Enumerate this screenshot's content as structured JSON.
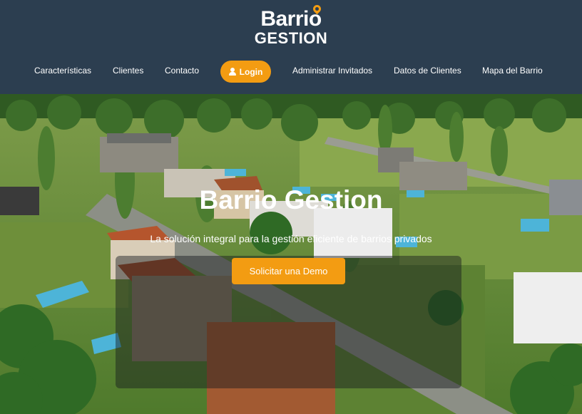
{
  "brand": {
    "logo_top": "Barrio",
    "logo_bottom": "GESTION"
  },
  "nav": {
    "items": [
      {
        "label": "Características"
      },
      {
        "label": "Clientes"
      },
      {
        "label": "Contacto"
      },
      {
        "label": "Administrar Invitados"
      },
      {
        "label": "Datos de Clientes"
      },
      {
        "label": "Mapa del Barrio"
      }
    ],
    "login_label": "Login",
    "login_icon": "user-icon"
  },
  "hero": {
    "title": "Barrio Gestion",
    "subtitle": "La solución integral para la gestión eficiente de barrios privados",
    "cta_label": "Solicitar una Demo"
  },
  "colors": {
    "header_bg": "#2c3e50",
    "accent": "#f39c12",
    "text": "#ffffff"
  }
}
